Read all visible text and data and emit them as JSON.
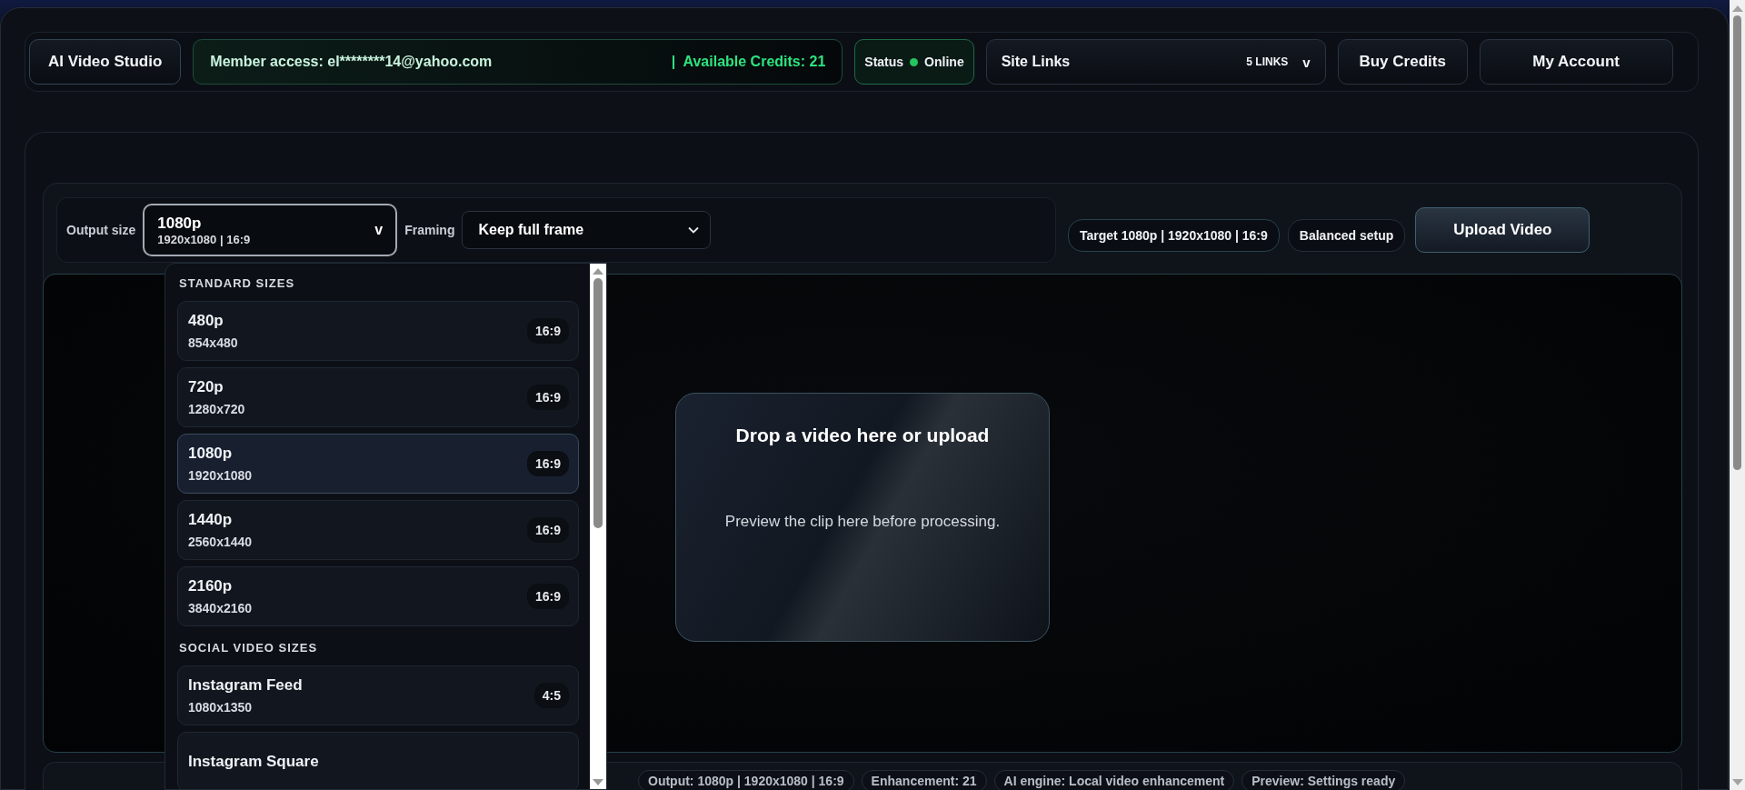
{
  "header": {
    "brand": "AI Video Studio",
    "member": {
      "label": "Member access: el********14@yahoo.com",
      "credits": "|  Available Credits: 21"
    },
    "status": {
      "label": "Status",
      "value": "Online",
      "online": true
    },
    "site_links": {
      "label": "Site Links",
      "count": "5 LINKS",
      "caret": "v"
    },
    "buttons": [
      "Buy Credits",
      "My Account"
    ]
  },
  "toolbar": {
    "output_size": {
      "label": "Output size",
      "value": "1080p",
      "detail": "1920x1080 | 16:9",
      "caret": "v",
      "expanded": true
    },
    "framing": {
      "label": "Framing",
      "value": "Keep full frame"
    },
    "chips": [
      "Target 1080p | 1920x1080 | 16:9",
      "Balanced setup"
    ],
    "upload": "Upload Video"
  },
  "size_menu": {
    "groups": [
      {
        "title": "STANDARD SIZES",
        "items": [
          {
            "name": "480p",
            "size": "854x480",
            "ratio": "16:9",
            "selected": false
          },
          {
            "name": "720p",
            "size": "1280x720",
            "ratio": "16:9",
            "selected": false
          },
          {
            "name": "1080p",
            "size": "1920x1080",
            "ratio": "16:9",
            "selected": true
          },
          {
            "name": "1440p",
            "size": "2560x1440",
            "ratio": "16:9",
            "selected": false
          },
          {
            "name": "2160p",
            "size": "3840x2160",
            "ratio": "16:9",
            "selected": false
          }
        ]
      },
      {
        "title": "SOCIAL VIDEO SIZES",
        "items": [
          {
            "name": "Instagram Feed",
            "size": "1080x1350",
            "ratio": "4:5",
            "selected": false
          },
          {
            "name": "Instagram Square",
            "selected": false
          }
        ]
      }
    ]
  },
  "drop_zone": {
    "title": "Drop a video here or upload",
    "hint": "Preview the clip here before processing."
  },
  "status_bar": [
    "Output: 1080p | 1920x1080 | 16:9",
    "Enhancement: 21",
    "AI engine: Local video enhancement",
    "Preview: Settings ready"
  ]
}
